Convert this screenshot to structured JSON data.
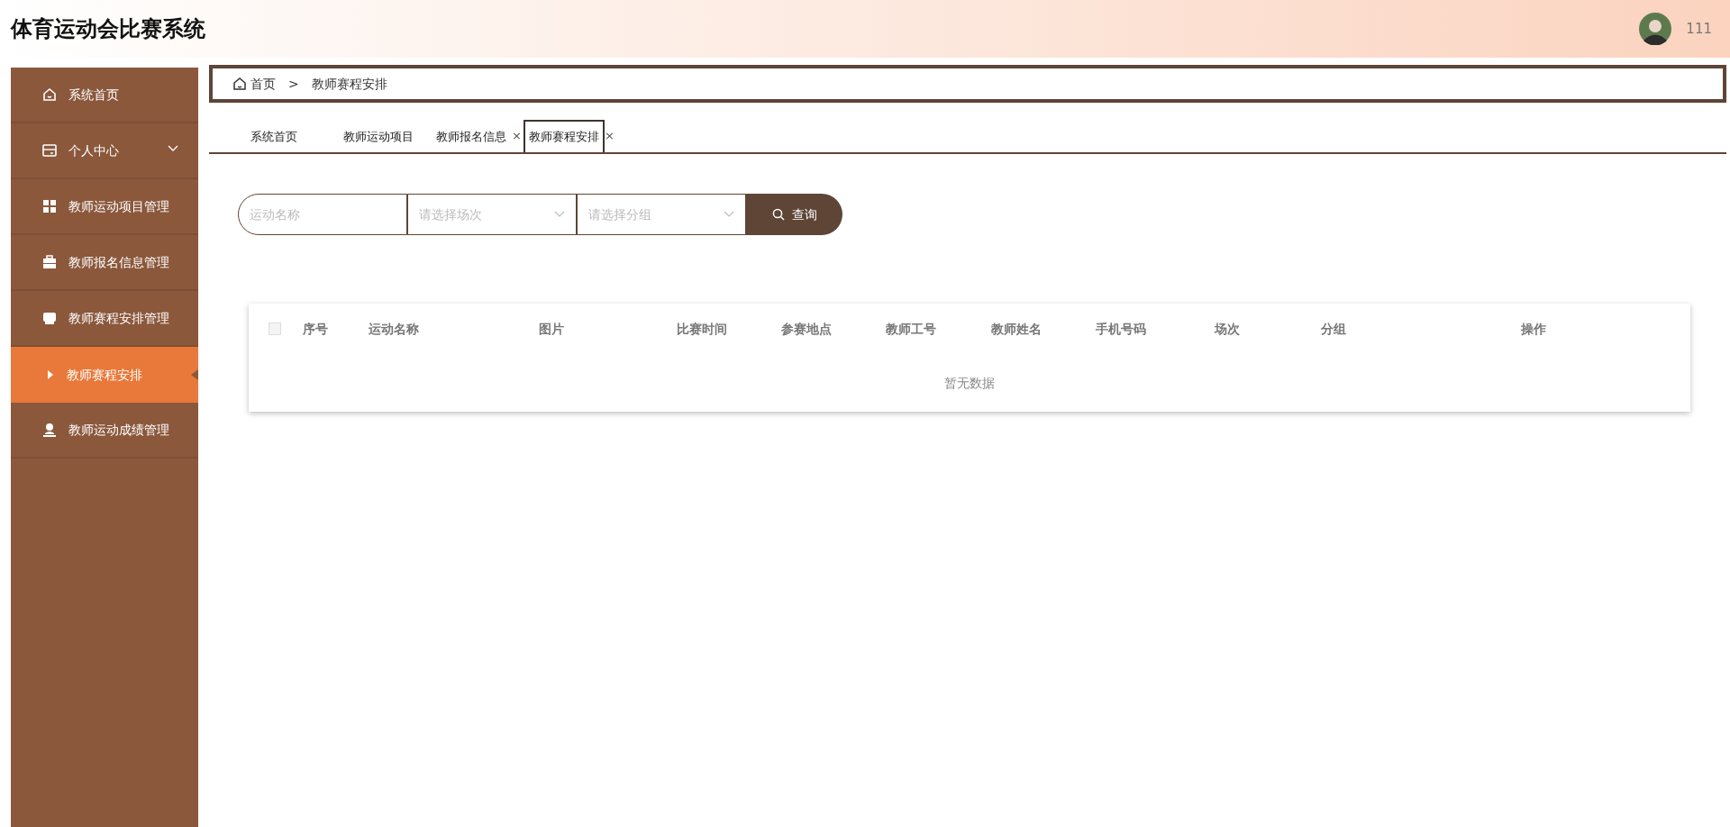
{
  "header": {
    "title": "体育运动会比赛系统",
    "user": {
      "name": "111"
    }
  },
  "sidebar": {
    "items": [
      {
        "label": "系统首页",
        "kind": "home",
        "selected": false
      },
      {
        "label": "个人中心",
        "kind": "card",
        "selected": false,
        "collapsed": true
      },
      {
        "label": "教师运动项目管理",
        "kind": "grid",
        "selected": false
      },
      {
        "label": "教师报名信息管理",
        "kind": "briefcase",
        "selected": false
      },
      {
        "label": "教师赛程安排管理",
        "kind": "monitor",
        "selected": false,
        "children": [
          {
            "label": "教师赛程安排",
            "selected": true
          }
        ]
      },
      {
        "label": "教师运动成绩管理",
        "kind": "user",
        "selected": false
      }
    ]
  },
  "breadcrumb": {
    "home": "首页",
    "separator": ">",
    "current": "教师赛程安排"
  },
  "tabs": [
    {
      "label": "系统首页",
      "selected": false
    },
    {
      "label": "教师运动项目",
      "selected": false
    },
    {
      "label": "教师报名信息",
      "selected": false,
      "close": "×"
    },
    {
      "label": "教师赛程安排",
      "selected": true,
      "close": "×"
    }
  ],
  "search": {
    "name_field": {
      "placeholder": "运动名称"
    },
    "session_select": {
      "placeholder": "请选择场次"
    },
    "group_select": {
      "placeholder": "请选择分组"
    },
    "button": "查询"
  },
  "table": {
    "columns": [
      "序号",
      "运动名称",
      "图片",
      "比赛时间",
      "参赛地点",
      "教师工号",
      "教师姓名",
      "手机号码",
      "场次",
      "分组",
      "操作"
    ],
    "select_all": {
      "checked": false
    },
    "empty_text": "暂无数据"
  }
}
